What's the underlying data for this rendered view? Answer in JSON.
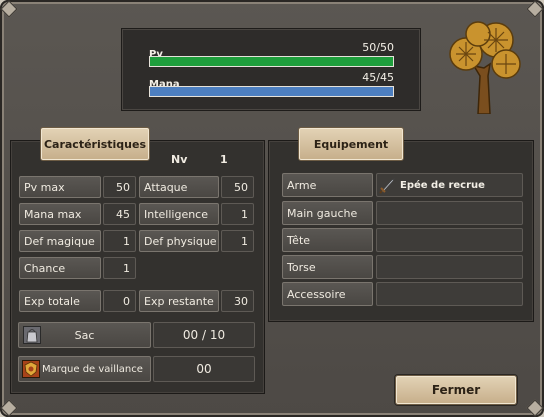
{
  "status": {
    "hp_label": "Pv",
    "hp_value": "50/50",
    "hp_fraction": 1.0,
    "hp_color": "#1e9e3c",
    "mana_label": "Mana",
    "mana_value": "45/45",
    "mana_fraction": 1.0,
    "mana_color": "#4d7fc0"
  },
  "characteristics": {
    "tab_label": "Caractéristiques",
    "level_label": "Nv",
    "level_value": "1",
    "stats": [
      {
        "label": "Pv max",
        "value": "50"
      },
      {
        "label": "Attaque",
        "value": "50"
      },
      {
        "label": "Mana max",
        "value": "45"
      },
      {
        "label": "Intelligence",
        "value": "1"
      },
      {
        "label": "Def magique",
        "value": "1"
      },
      {
        "label": "Def physique",
        "value": "1"
      },
      {
        "label": "Chance",
        "value": "1"
      }
    ],
    "exp_total_label": "Exp totale",
    "exp_total_value": "0",
    "exp_remaining_label": "Exp restante",
    "exp_remaining_value": "30",
    "bag_label": "Sac",
    "bag_value": "00 / 10",
    "badge_label": "Marque de vaillance",
    "badge_value": "00"
  },
  "equipment": {
    "tab_label": "Equipement",
    "slots": [
      {
        "label": "Arme",
        "item": "Epée de recrue",
        "item_icon": "sword-icon"
      },
      {
        "label": "Main gauche",
        "item": ""
      },
      {
        "label": "Tête",
        "item": ""
      },
      {
        "label": "Torse",
        "item": ""
      },
      {
        "label": "Accessoire",
        "item": ""
      }
    ]
  },
  "close_label": "Fermer"
}
